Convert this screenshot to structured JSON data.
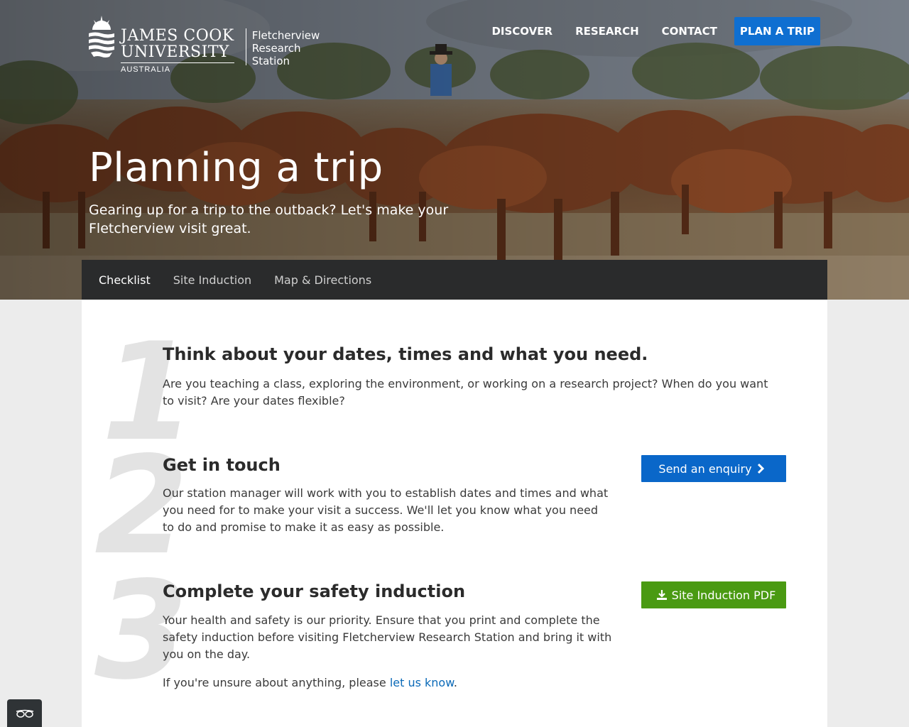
{
  "brand": {
    "university_line1": "JAMES COOK",
    "university_line2": "UNIVERSITY",
    "country": "AUSTRALIA",
    "station_line1": "Fletcherview",
    "station_line2": "Research",
    "station_line3": "Station"
  },
  "nav": {
    "items": [
      "DISCOVER",
      "RESEARCH",
      "CONTACT"
    ],
    "cta": "PLAN A TRIP",
    "cta_color": "#0f6fd1"
  },
  "hero": {
    "title": "Planning a trip",
    "subtitle": "Gearing up for a trip to the outback? Let's make your Fletcherview visit great."
  },
  "tabs": {
    "items": [
      "Checklist",
      "Site Induction",
      "Map & Directions"
    ],
    "active": "Checklist"
  },
  "steps": [
    {
      "number": "1",
      "heading": "Think about your dates, times and what you need.",
      "body": "Are you teaching a class, exploring the environment, or working on a research project? When do you want to visit? Are your dates flexible?"
    },
    {
      "number": "2",
      "heading": "Get in touch",
      "body": "Our station manager will work with you to establish dates and times and what you need for to make your visit a success. We'll let you know what you need to do and promise to make it as easy as possible.",
      "button": "Send an enquiry",
      "button_icon": "chevron-right-icon",
      "button_color": "#0a67c9"
    },
    {
      "number": "3",
      "heading": "Complete your safety induction",
      "body": "Your health and safety is our priority. Ensure that you print and complete the safety induction before visiting Fletcherview Research Station and bring it with you on the day.",
      "note_prefix": "If you're unsure about anything, please ",
      "note_link": "let us know",
      "note_suffix": ".",
      "button": "Site Induction PDF",
      "button_icon": "download-icon",
      "button_color": "#4a9a12"
    }
  ],
  "accessibility_widget": {
    "icon": "glasses-icon"
  }
}
